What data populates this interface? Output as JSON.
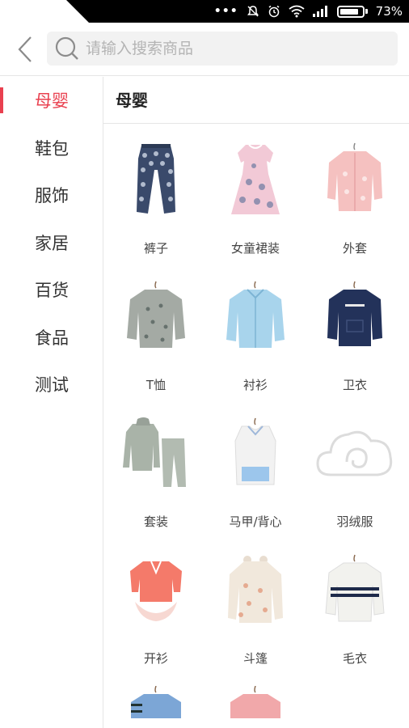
{
  "status_bar": {
    "battery_text": "73%"
  },
  "search": {
    "placeholder": "请输入搜索商品"
  },
  "sidebar": {
    "items": [
      {
        "label": "母婴",
        "active": true
      },
      {
        "label": "鞋包"
      },
      {
        "label": "服饰"
      },
      {
        "label": "家居"
      },
      {
        "label": "百货"
      },
      {
        "label": "食品"
      },
      {
        "label": "测试"
      }
    ]
  },
  "main": {
    "category_title": "母婴",
    "products": [
      {
        "label": "裤子",
        "icon": "pants-icon"
      },
      {
        "label": "女童裙装",
        "icon": "dress-icon"
      },
      {
        "label": "外套",
        "icon": "jacket-icon"
      },
      {
        "label": "T恤",
        "icon": "tshirt-icon"
      },
      {
        "label": "衬衫",
        "icon": "shirt-icon"
      },
      {
        "label": "卫衣",
        "icon": "sweatshirt-icon"
      },
      {
        "label": "套装",
        "icon": "suit-icon"
      },
      {
        "label": "马甲/背心",
        "icon": "vest-icon"
      },
      {
        "label": "羽绒服",
        "icon": "placeholder-cloud-icon"
      },
      {
        "label": "开衫",
        "icon": "cardigan-icon"
      },
      {
        "label": "斗篷",
        "icon": "cape-icon"
      },
      {
        "label": "毛衣",
        "icon": "sweater-icon"
      }
    ]
  },
  "colors": {
    "accent": "#e9404f",
    "divider": "#e5e5e5",
    "search_bg": "#f2f2f2"
  }
}
